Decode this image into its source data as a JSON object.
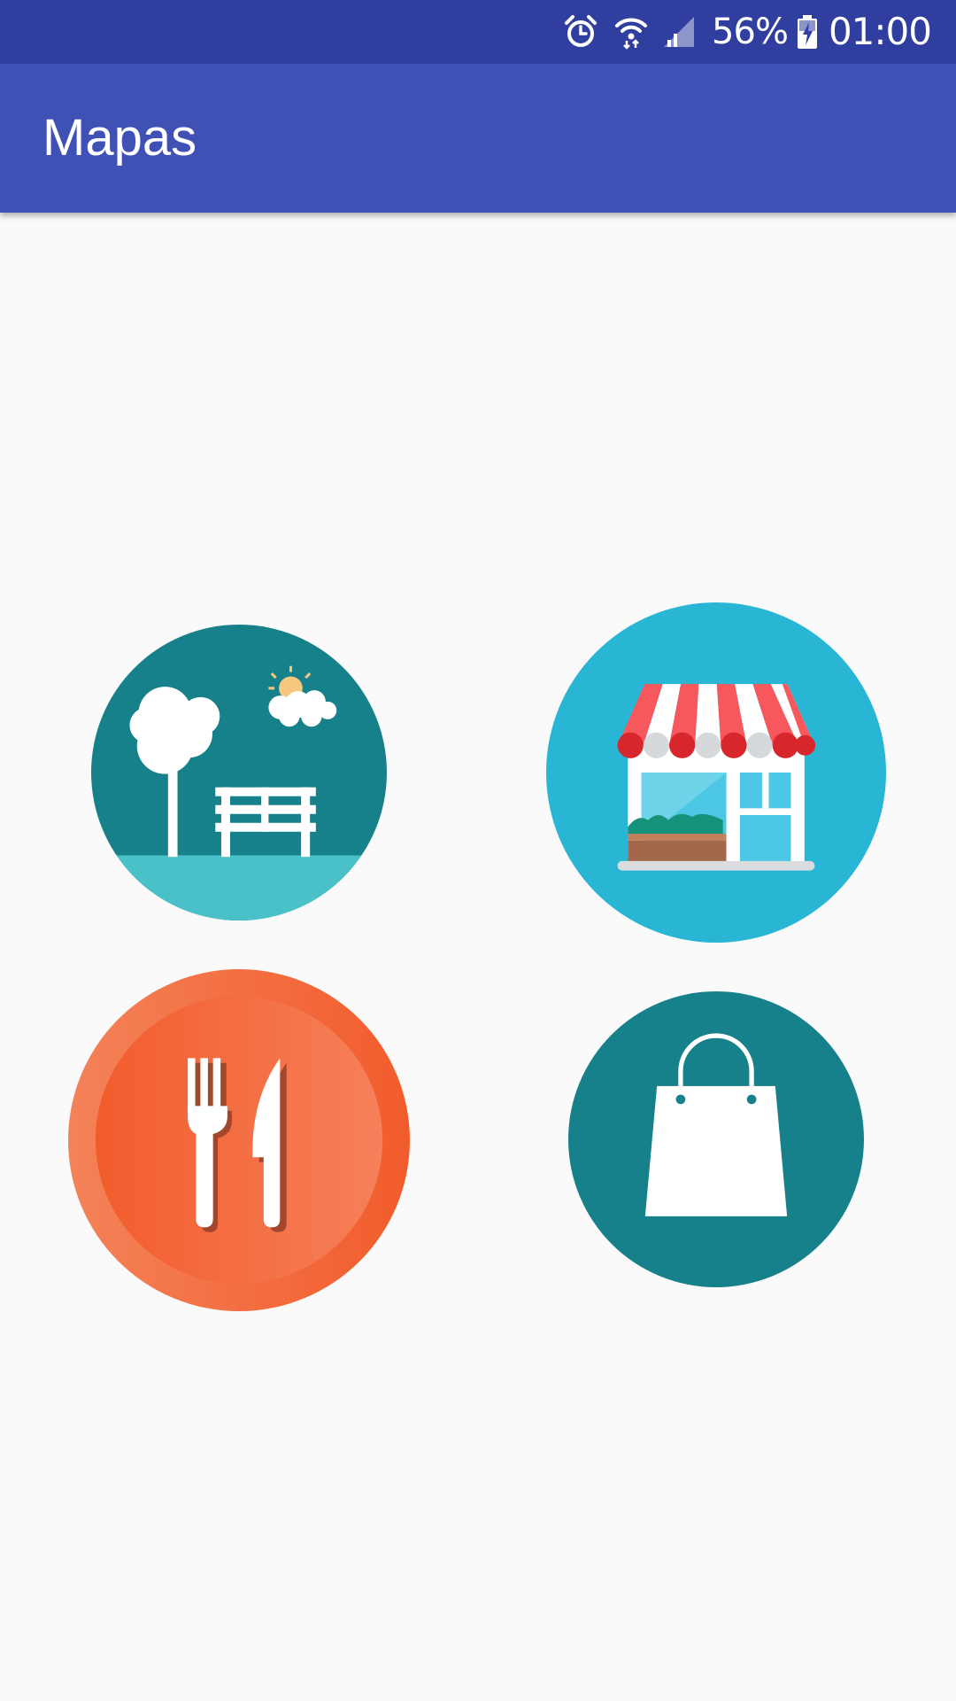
{
  "status_bar": {
    "icons": [
      "alarm-icon",
      "wifi-icon",
      "cell-signal-icon",
      "battery-charging-icon"
    ],
    "battery_percent": "56%",
    "time": "01:00"
  },
  "app_bar": {
    "title": "Mapas"
  },
  "categories": [
    {
      "id": "park",
      "icon": "park-bench-icon",
      "color": "#16808b"
    },
    {
      "id": "store",
      "icon": "storefront-icon",
      "color": "#29b6d5"
    },
    {
      "id": "restaurant",
      "icon": "fork-knife-icon",
      "color": "#f26232"
    },
    {
      "id": "shopping",
      "icon": "shopping-bag-icon",
      "color": "#16808b"
    }
  ],
  "colors": {
    "status_bar": "#303f9f",
    "app_bar": "#3f51b5",
    "background": "#fafafa"
  }
}
